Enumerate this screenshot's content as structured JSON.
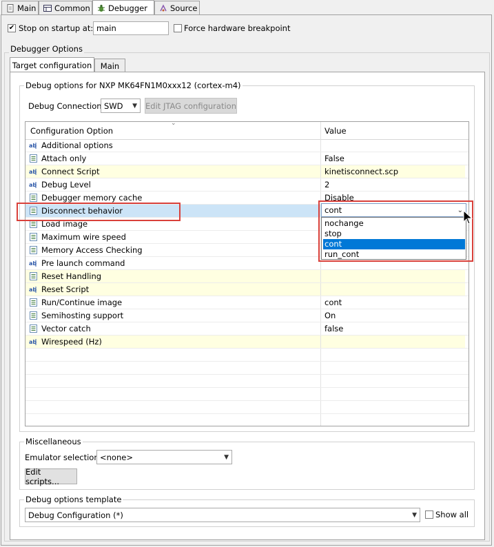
{
  "tabs": [
    {
      "label": "Main",
      "icon": "page-icon"
    },
    {
      "label": "Common",
      "icon": "table-icon"
    },
    {
      "label": "Debugger",
      "icon": "bug-icon"
    },
    {
      "label": "Source",
      "icon": "source-icon"
    }
  ],
  "startup": {
    "stop_label": "Stop on startup at:",
    "stop_checked": true,
    "stop_value": "main",
    "force_label": "Force hardware breakpoint",
    "force_checked": false
  },
  "debugger_options": {
    "group_label": "Debugger Options",
    "subtabs": [
      "Target configuration",
      "Main"
    ],
    "debug_options_label": "Debug options for NXP MK64FN1M0xxx12 (cortex-m4)",
    "connection_label": "Debug Connection",
    "connection_value": "SWD",
    "edit_jtag_label": "Edit JTAG configuration"
  },
  "table": {
    "col_option": "Configuration Option",
    "col_value": "Value",
    "rows": [
      {
        "icon": "abc-icon",
        "name": "Additional options",
        "value": "",
        "style": "plain"
      },
      {
        "icon": "list-icon",
        "name": "Attach only",
        "value": "False",
        "style": "plain"
      },
      {
        "icon": "abc-icon",
        "name": "Connect Script",
        "value": "kinetisconnect.scp",
        "style": "yellow"
      },
      {
        "icon": "abc-icon",
        "name": "Debug Level",
        "value": "2",
        "style": "plain"
      },
      {
        "icon": "list-icon",
        "name": "Debugger memory cache",
        "value": "Disable",
        "style": "plain"
      },
      {
        "icon": "list-icon",
        "name": "Disconnect behavior",
        "value": "",
        "style": "selected"
      },
      {
        "icon": "list-icon",
        "name": "Load image",
        "value": "",
        "style": "plain"
      },
      {
        "icon": "list-icon",
        "name": "Maximum wire speed",
        "value": "",
        "style": "plain"
      },
      {
        "icon": "list-icon",
        "name": "Memory Access Checking",
        "value": "",
        "style": "plain"
      },
      {
        "icon": "abc-icon",
        "name": "Pre launch command",
        "value": "",
        "style": "plain"
      },
      {
        "icon": "list-icon",
        "name": "Reset Handling",
        "value": "",
        "style": "yellow"
      },
      {
        "icon": "abc-icon",
        "name": "Reset Script",
        "value": "",
        "style": "yellow"
      },
      {
        "icon": "list-icon",
        "name": "Run/Continue image",
        "value": "cont",
        "style": "plain"
      },
      {
        "icon": "list-icon",
        "name": "Semihosting support",
        "value": "On",
        "style": "plain"
      },
      {
        "icon": "list-icon",
        "name": "Vector catch",
        "value": "false",
        "style": "plain"
      },
      {
        "icon": "abc-icon",
        "name": "Wirespeed (Hz)",
        "value": "",
        "style": "yellow"
      }
    ]
  },
  "dropdown": {
    "current": "cont",
    "options": [
      "nochange",
      "stop",
      "cont",
      "run_cont"
    ],
    "selected_index": 2
  },
  "misc": {
    "group_label": "Miscellaneous",
    "emulator_label": "Emulator selection",
    "emulator_value": "<none>",
    "edit_scripts_label": "Edit scripts..."
  },
  "template": {
    "group_label": "Debug options template",
    "value": "Debug Configuration (*)",
    "show_all_label": "Show all",
    "show_all_checked": false
  },
  "colors": {
    "highlight_red": "#d9403a",
    "row_yellow": "#ffffe1",
    "row_selected": "#cce4f7",
    "dropdown_selected": "#0078d7"
  }
}
